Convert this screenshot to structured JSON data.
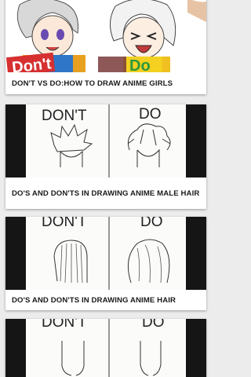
{
  "videos": [
    {
      "title": "DON'T VS DO:HOW TO DRAW ANIME GIRLS",
      "thumbnail_labels": [
        "Don't",
        "Do"
      ]
    },
    {
      "title": "DO'S AND DON'TS IN DRAWING ANIME MALE HAIR",
      "thumbnail_labels": [
        "DON'T",
        "DO"
      ]
    },
    {
      "title": "DO'S AND DON'TS IN DRAWING ANIME HAIR",
      "thumbnail_labels": [
        "DON'T",
        "DO"
      ]
    },
    {
      "title": "",
      "thumbnail_labels": [
        "DON'T",
        "DO"
      ]
    }
  ],
  "colors": {
    "background": "#ececec",
    "card": "#ffffff",
    "title_text": "#1a1a1a",
    "thumb_frame": "#151515"
  }
}
